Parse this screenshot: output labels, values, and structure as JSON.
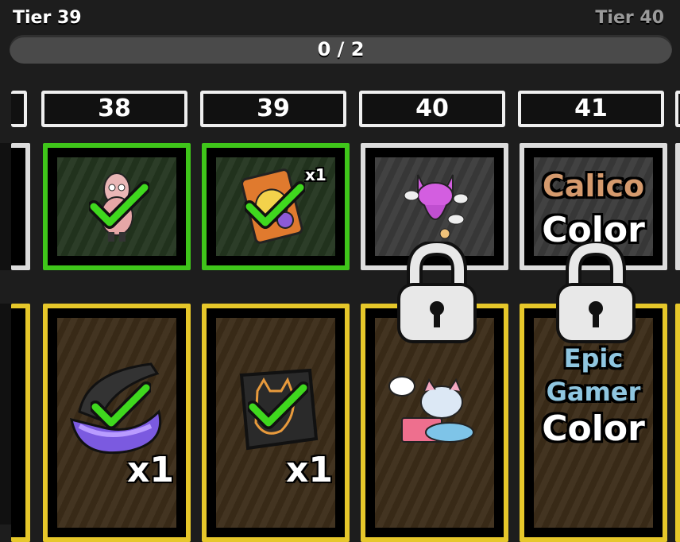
{
  "header": {
    "current_tier": "Tier 39",
    "next_tier": "Tier 40",
    "progress_text": "0 / 2",
    "progress_value": 0,
    "progress_max": 2
  },
  "tiers": [
    "38",
    "39",
    "40",
    "41"
  ],
  "free_track": [
    {
      "tier": "38",
      "icon": "character-figure-icon",
      "claimed": true
    },
    {
      "tier": "39",
      "icon": "treat-bag-icon",
      "claimed": true,
      "qty": "x1"
    },
    {
      "tier": "40",
      "icon": "pink-cat-avatar-icon",
      "claimed": false
    },
    {
      "tier": "41",
      "icon": "color-swatch-icon",
      "claimed": false,
      "text_line1": "Calico",
      "text_line2": "Color"
    }
  ],
  "premium_track": [
    {
      "tier": "38",
      "icon": "paint-brush-icon",
      "claimed": true,
      "qty": "x1"
    },
    {
      "tier": "39",
      "icon": "cat-sticker-icon",
      "claimed": true,
      "qty": "x1"
    },
    {
      "tier": "40",
      "icon": "gamer-cat-avatar-icon",
      "claimed": false
    },
    {
      "tier": "41",
      "icon": "color-swatch-icon",
      "claimed": false,
      "text_line1": "Epic",
      "text_line2": "Gamer",
      "text_line3": "Color"
    }
  ],
  "colors": {
    "claimed_border": "#3fc61a",
    "locked_border": "#dcdcdc",
    "premium_border": "#e6c72a",
    "check_green": "#3fd81e",
    "calico": "#d59a6d",
    "epic_gamer": "#8fc6e0"
  }
}
